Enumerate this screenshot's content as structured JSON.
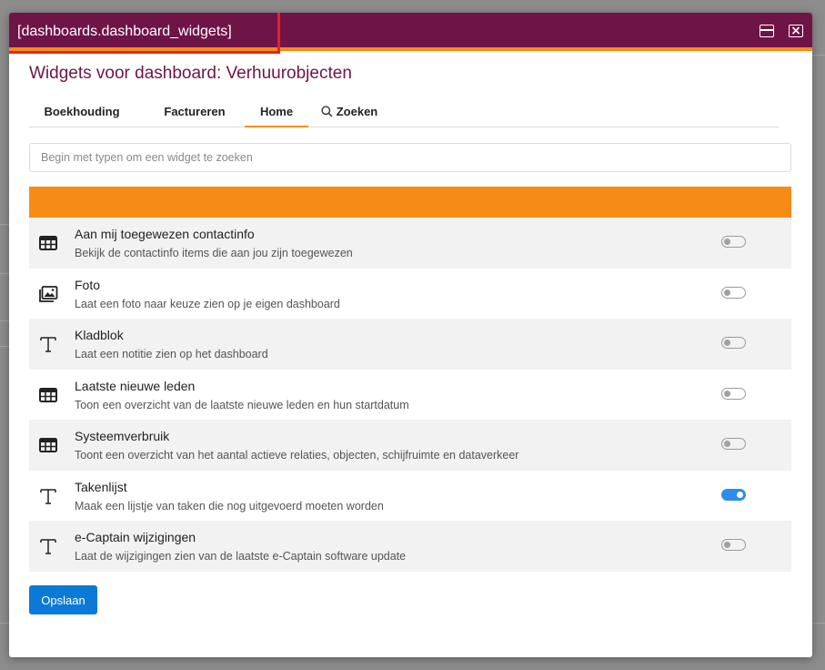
{
  "window": {
    "title": "[dashboards.dashboard_widgets]"
  },
  "heading": "Widgets voor dashboard: Verhuurobjecten",
  "tabs": [
    {
      "label": "Boekhouding",
      "active": false
    },
    {
      "label": "Factureren",
      "active": false
    },
    {
      "label": "Home",
      "active": true
    },
    {
      "label": "Zoeken",
      "active": false,
      "icon": "search-icon"
    }
  ],
  "search": {
    "placeholder": "Begin met typen om een widget te zoeken",
    "value": ""
  },
  "widgets": [
    {
      "name": "Aan mij toegewezen contactinfo",
      "description": "Bekijk de contactinfo items die aan jou zijn toegewezen",
      "icon": "table-icon",
      "enabled": false
    },
    {
      "name": "Foto",
      "description": "Laat een foto naar keuze zien op je eigen dashboard",
      "icon": "image-icon",
      "enabled": false
    },
    {
      "name": "Kladblok",
      "description": "Laat een notitie zien op het dashboard",
      "icon": "text-icon",
      "enabled": false
    },
    {
      "name": "Laatste nieuwe leden",
      "description": "Toon een overzicht van de laatste nieuwe leden en hun startdatum",
      "icon": "table-icon",
      "enabled": false
    },
    {
      "name": "Systeemverbruik",
      "description": "Toont een overzicht van het aantal actieve relaties, objecten, schijfruimte en dataverkeer",
      "icon": "table-icon",
      "enabled": false
    },
    {
      "name": "Takenlijst",
      "description": "Maak een lijstje van taken die nog uitgevoerd moeten worden",
      "icon": "text-icon",
      "enabled": true
    },
    {
      "name": "e-Captain wijzigingen",
      "description": "Laat de wijzigingen zien van de laatste e-Captain software update",
      "icon": "text-icon",
      "enabled": false
    }
  ],
  "save_label": "Opslaan",
  "colors": {
    "titlebar": "#6f1447",
    "accent": "#f68c15",
    "primary_button": "#0a7ad6",
    "toggle_on": "#2d8cf0",
    "highlight": "#e5222b"
  }
}
